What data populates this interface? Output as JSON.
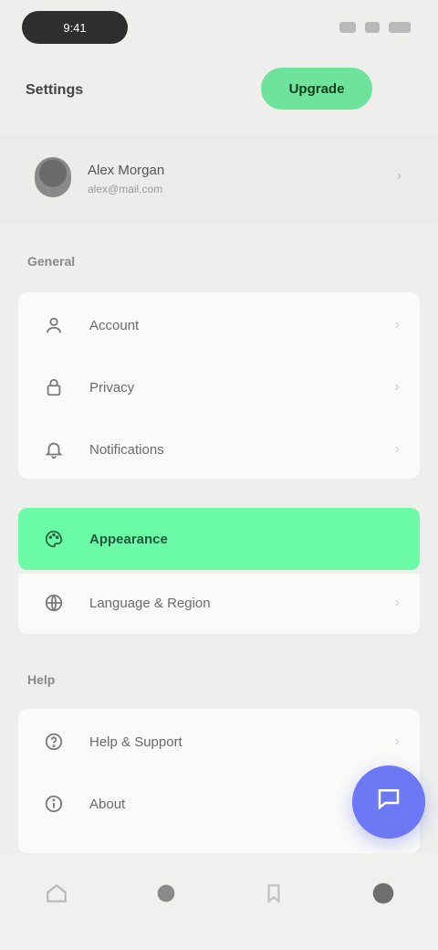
{
  "status": {
    "time": "9:41"
  },
  "header": {
    "title": "Settings",
    "action_label": "Upgrade"
  },
  "profile": {
    "name": "Alex Morgan",
    "subtitle": "alex@mail.com"
  },
  "sections": [
    {
      "label": "General",
      "items": [
        {
          "label": "Account",
          "icon": "user-icon"
        },
        {
          "label": "Privacy",
          "icon": "lock-icon"
        },
        {
          "label": "Notifications",
          "icon": "bell-icon"
        },
        {
          "label": "Appearance",
          "icon": "palette-icon",
          "active": true
        },
        {
          "label": "Language & Region",
          "icon": "globe-icon"
        }
      ]
    },
    {
      "label": "Help",
      "items": [
        {
          "label": "Help & Support",
          "icon": "help-icon"
        },
        {
          "label": "About",
          "icon": "info-icon"
        }
      ]
    }
  ],
  "fab": {
    "icon": "chat-icon"
  },
  "bottom_nav": [
    {
      "icon": "home-icon"
    },
    {
      "icon": "search-icon"
    },
    {
      "icon": "bookmark-icon"
    },
    {
      "icon": "profile-icon"
    }
  ],
  "colors": {
    "accent_green": "#6cfca8",
    "fab_blue": "#6d78f5"
  }
}
